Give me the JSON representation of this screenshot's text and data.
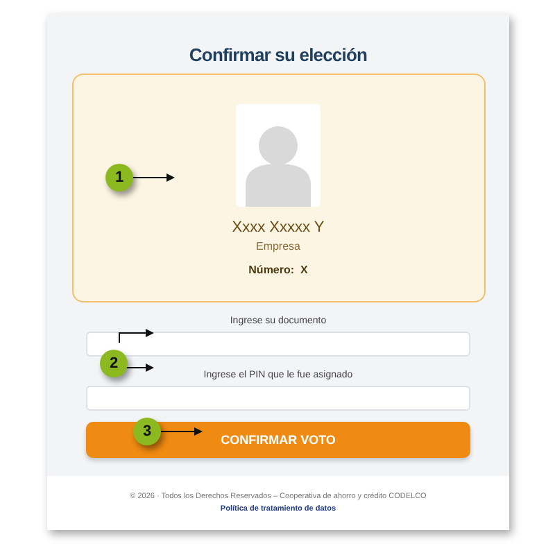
{
  "title": "Confirmar su elección",
  "candidate": {
    "name": "Xxxx Xxxxx Y",
    "company": "Empresa",
    "number": "Número:  X"
  },
  "fields": [
    {
      "label": "Ingrese su documento"
    },
    {
      "label": "Ingrese el PIN que le fue asignado"
    }
  ],
  "submit_button": "CONFIRMAR VOTO",
  "footer": {
    "copyright": "© 2026 · Todos los Derechos Reservados – Cooperativa de ahorro y crédito CODELCO",
    "link": "Política de tratamiento de datos"
  },
  "annotations": [
    {
      "number": "1",
      "kind": "single"
    },
    {
      "number": "2",
      "kind": "double"
    },
    {
      "number": "3",
      "kind": "single"
    }
  ]
}
